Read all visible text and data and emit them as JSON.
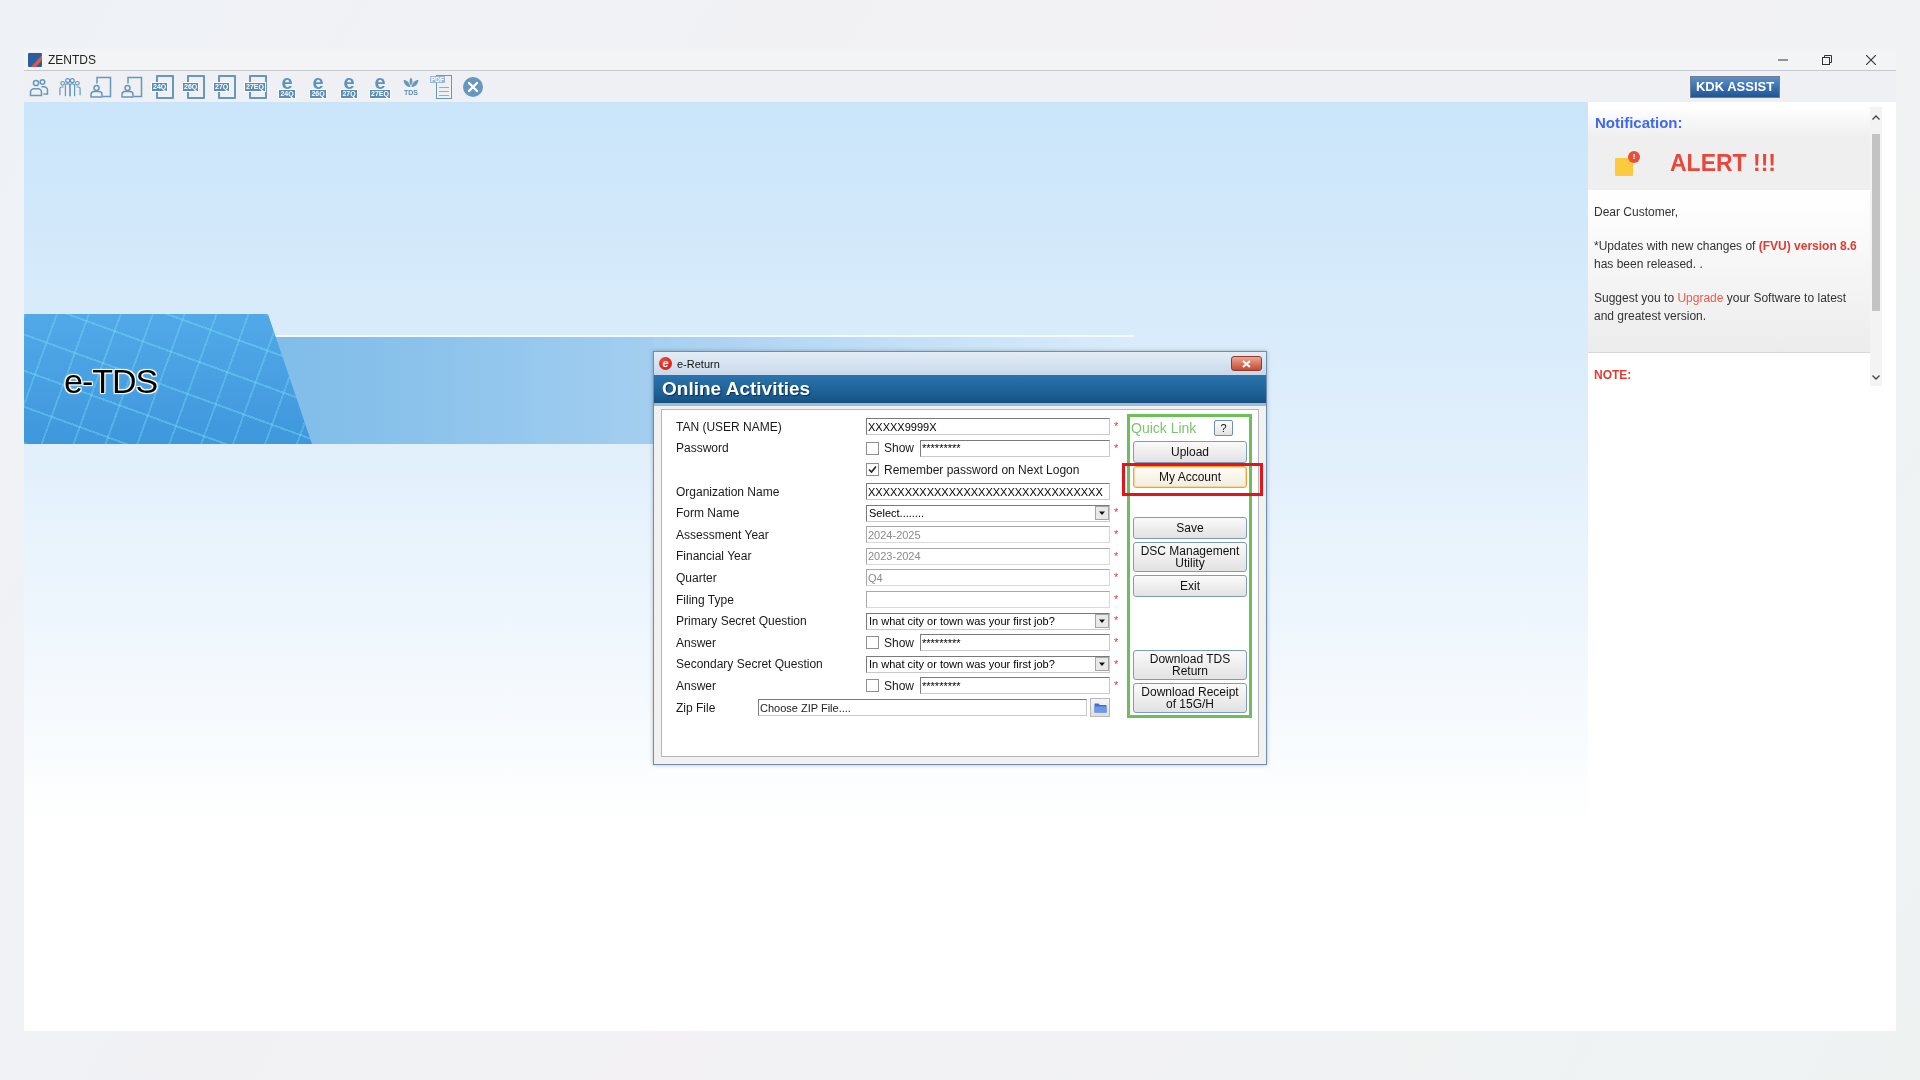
{
  "window": {
    "title": "ZENTDS",
    "controls": [
      {
        "kind": "minimize"
      },
      {
        "kind": "restore"
      },
      {
        "kind": "close"
      }
    ]
  },
  "toolbar": {
    "items": [
      {
        "kind": "user"
      },
      {
        "kind": "users"
      },
      {
        "kind": "person-form"
      },
      {
        "kind": "person-form"
      },
      {
        "kind": "form",
        "label": "24Q"
      },
      {
        "kind": "form",
        "label": "26Q"
      },
      {
        "kind": "form",
        "label": "27Q"
      },
      {
        "kind": "form",
        "label": "27EQ"
      },
      {
        "kind": "e-form",
        "glyph": "e",
        "label": "24Q"
      },
      {
        "kind": "e-form",
        "glyph": "e",
        "label": "26Q"
      },
      {
        "kind": "e-form",
        "glyph": "e",
        "label": "27Q"
      },
      {
        "kind": "e-form",
        "glyph": "e",
        "label": "27EQ"
      },
      {
        "kind": "emblem",
        "label": "TDS"
      },
      {
        "kind": "pdf",
        "label": "PDF"
      },
      {
        "kind": "close"
      }
    ],
    "assist_button": "KDK ASSIST"
  },
  "banner": {
    "title": "e-TDS"
  },
  "notification": {
    "heading": "Notification:",
    "alert": {
      "badge": "!",
      "text": "ALERT !!!"
    },
    "paragraphs": [
      [
        {
          "kind": "plain",
          "text": "Dear Customer,"
        }
      ],
      [
        {
          "kind": "plain",
          "text": "*Updates with new changes of "
        },
        {
          "kind": "strong",
          "text": "(FVU) version 8.6"
        },
        {
          "kind": "plain",
          "text": " has been released. ."
        }
      ],
      [
        {
          "kind": "plain",
          "text": "Suggest you to "
        },
        {
          "kind": "accent",
          "text": "Upgrade"
        },
        {
          "kind": "plain",
          "text": " your Software to latest and greatest version."
        }
      ]
    ],
    "note": "NOTE:"
  },
  "dialog": {
    "logo": "e",
    "title": "e-Return",
    "heading": "Online Activities",
    "rows": [
      {
        "kind": "text",
        "label": "TAN (USER NAME)",
        "value": "XXXXX9999X",
        "disabled": false,
        "required_mark": "*"
      },
      {
        "kind": "password",
        "label": "Password",
        "show_label": "Show",
        "show_checked": false,
        "value": "*********",
        "required_mark": "*"
      },
      {
        "kind": "checkbox",
        "text": "Remember password on Next Logon",
        "checked": true
      },
      {
        "kind": "text",
        "label": "Organization Name",
        "value": "XXXXXXXXXXXXXXXXXXXXXXXXXXXXXXXX",
        "disabled": false
      },
      {
        "kind": "select",
        "label": "Form Name",
        "value": "Select........",
        "required_mark": "*"
      },
      {
        "kind": "text",
        "label": "Assessment Year",
        "value": "2024-2025",
        "disabled": true,
        "required_mark": "*"
      },
      {
        "kind": "text",
        "label": "Financial Year",
        "value": "2023-2024",
        "disabled": true,
        "required_mark": "*"
      },
      {
        "kind": "text",
        "label": "Quarter",
        "value": "Q4",
        "disabled": true,
        "required_mark": "*"
      },
      {
        "kind": "text",
        "label": "Filing Type",
        "disabled": true,
        "required_mark": "*"
      },
      {
        "kind": "select",
        "label": "Primary Secret Question",
        "value": "In what city or town was your first job?",
        "required_mark": "*"
      },
      {
        "kind": "password",
        "label": "Answer",
        "show_label": "Show",
        "show_checked": false,
        "value": "*********",
        "required_mark": "*"
      },
      {
        "kind": "select",
        "label": "Secondary Secret Question",
        "value": "In what city or town was your first job?",
        "required_mark": "*"
      },
      {
        "kind": "password",
        "label": "Answer",
        "show_label": "Show",
        "show_checked": false,
        "value": "*********",
        "required_mark": "*"
      },
      {
        "kind": "file",
        "label": "Zip File",
        "placeholder": "Choose ZIP File...."
      }
    ],
    "quick_link": {
      "title": "Quick Link",
      "help": "?",
      "groups": [
        {
          "buttons": [
            {
              "label": "Upload",
              "focused": false,
              "highlighted": false
            },
            {
              "label": "My Account",
              "focused": true,
              "highlighted": true
            }
          ]
        },
        {
          "buttons": [
            {
              "label": "Save",
              "focused": false,
              "highlighted": false
            },
            {
              "label": "DSC Management Utility",
              "focused": false,
              "highlighted": false
            },
            {
              "label": "Exit",
              "focused": false,
              "highlighted": false
            }
          ]
        },
        {
          "buttons": [
            {
              "label": "Download TDS Return",
              "focused": false,
              "highlighted": false
            },
            {
              "label": "Download Receipt of 15G/H",
              "focused": false,
              "highlighted": false
            }
          ]
        }
      ]
    }
  }
}
